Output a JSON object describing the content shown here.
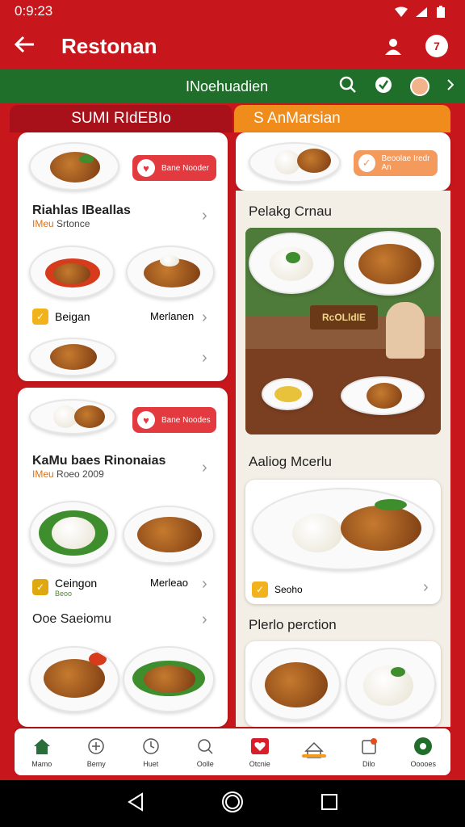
{
  "status": {
    "time": "0:9:23"
  },
  "appbar": {
    "title": "Restonan",
    "back_icon": "arrow-left-icon",
    "user_icon": "user-icon",
    "notif_badge": "7"
  },
  "subbar": {
    "label": "INoehuadien"
  },
  "left_column": {
    "header": "SUMI RIdEBIo",
    "card1": {
      "pill_text": "Bane Nooder",
      "item1_title": "Riahlas IBeallas",
      "item1_sub_accent": "IMeu",
      "item1_sub": "Srtonce",
      "row2_left": "Beigan",
      "row2_right": "Merlanen"
    },
    "card2": {
      "pill_text": "Bane Noodes",
      "item1_title": "KaMu baes Rinonaias",
      "item1_sub_accent": "IMeu",
      "item1_sub": "Roeo 2009",
      "row2_left": "Ceingon",
      "row2_sub": "Beoo",
      "row2_right": "Merleao",
      "item3_title": "Ooe Saeiomu"
    }
  },
  "right_column": {
    "header": "S AnMarsian",
    "pill_text": "Beoolae Iredr An",
    "section1_title": "Pelakg Crnau",
    "sign_text": "RcOLldIE",
    "section2_title": "Aaliog Mcerlu",
    "section2_check": "Seoho",
    "section3_title": "Plerlo perction"
  },
  "bottom_nav": [
    {
      "label": "Mamo",
      "icon": "home-icon"
    },
    {
      "label": "Bemy",
      "icon": "gift-icon"
    },
    {
      "label": "Huet",
      "icon": "clock-icon"
    },
    {
      "label": "Oolle",
      "icon": "search-icon"
    },
    {
      "label": "Otcnie",
      "icon": "heart-icon"
    },
    {
      "label": "",
      "icon": "house-outline-icon"
    },
    {
      "label": "Dilo",
      "icon": "bag-icon"
    },
    {
      "label": "Ooooes",
      "icon": "profile-icon"
    }
  ],
  "colors": {
    "primary": "#c8171c",
    "green": "#1f6e2a",
    "orange": "#f08c1c"
  }
}
